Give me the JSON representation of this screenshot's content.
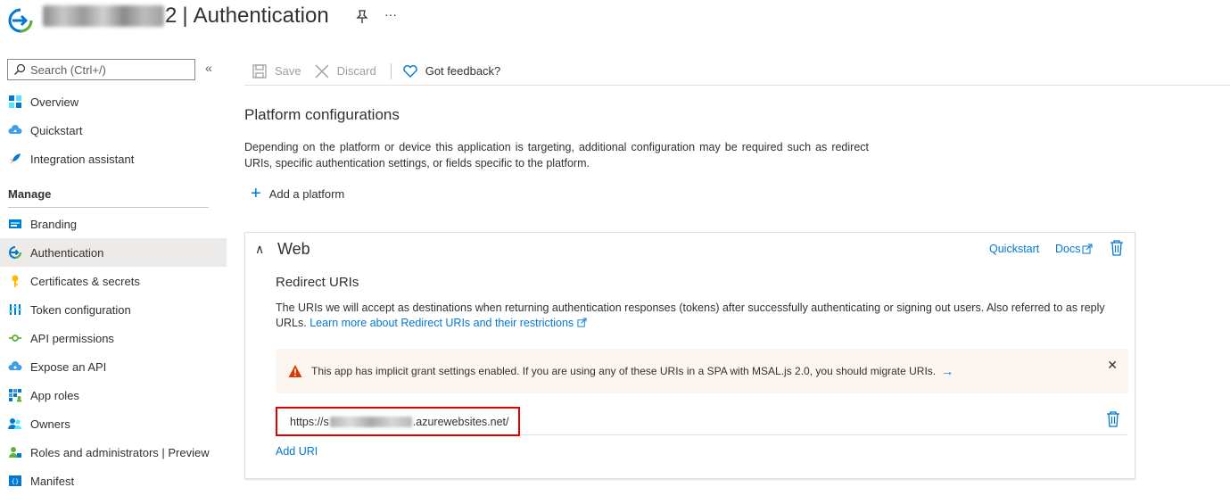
{
  "header": {
    "app_name_visible_suffix": "2",
    "separator": "|",
    "page_title": "Authentication",
    "pin_icon": "pin-icon",
    "more_icon": "ellipsis-icon",
    "more_glyph": "···"
  },
  "sidebar": {
    "search_placeholder": "Search (Ctrl+/)",
    "collapse_glyph": "«",
    "top_items": [
      {
        "label": "Overview",
        "icon": "overview-grid-icon"
      },
      {
        "label": "Quickstart",
        "icon": "quickstart-cloud-icon"
      },
      {
        "label": "Integration assistant",
        "icon": "rocket-icon"
      }
    ],
    "section_label": "Manage",
    "manage_items": [
      {
        "label": "Branding",
        "icon": "branding-icon"
      },
      {
        "label": "Authentication",
        "icon": "authentication-icon",
        "active": true
      },
      {
        "label": "Certificates & secrets",
        "icon": "key-icon"
      },
      {
        "label": "Token configuration",
        "icon": "token-bars-icon"
      },
      {
        "label": "API permissions",
        "icon": "api-permissions-icon"
      },
      {
        "label": "Expose an API",
        "icon": "expose-api-cloud-icon"
      },
      {
        "label": "App roles",
        "icon": "app-roles-grid-icon"
      },
      {
        "label": "Owners",
        "icon": "owners-people-icon"
      },
      {
        "label": "Roles and administrators | Preview",
        "icon": "roles-admin-icon"
      },
      {
        "label": "Manifest",
        "icon": "manifest-icon"
      }
    ]
  },
  "toolbar": {
    "save_label": "Save",
    "discard_label": "Discard",
    "feedback_label": "Got feedback?"
  },
  "main": {
    "title": "Platform configurations",
    "description": "Depending on the platform or device this application is targeting, additional configuration may be required such as redirect URIs, specific authentication settings, or fields specific to the platform.",
    "add_platform_label": "Add a platform",
    "add_platform_glyph": "+"
  },
  "web_card": {
    "chevron_glyph": "∧",
    "title": "Web",
    "quickstart_link": "Quickstart",
    "docs_link": "Docs",
    "redirect_title": "Redirect URIs",
    "redirect_desc": "The URIs we will accept as destinations when returning authentication responses (tokens) after successfully authenticating or signing out users. Also referred to as reply URLs.",
    "learn_more_link": "Learn more about Redirect URIs and their restrictions",
    "warning_text": "This app has implicit grant settings enabled. If you are using any of these URIs in a SPA with MSAL.js 2.0, you should migrate URIs.",
    "warning_arrow_glyph": "→",
    "warning_close_glyph": "✕",
    "uri_prefix": "https://s",
    "uri_suffix": ".azurewebsites.net/",
    "add_uri_label": "Add URI"
  },
  "colors": {
    "link_blue": "#0078d4",
    "highlight_red": "#e00000",
    "warning_bg": "#fdf6f0",
    "active_nav_bg": "#edebe9"
  }
}
